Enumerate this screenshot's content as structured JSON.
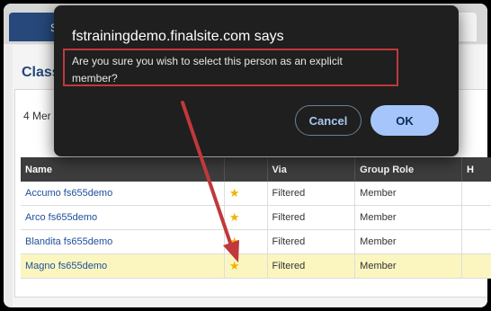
{
  "background": {
    "tab_label": "S",
    "page_heading": "Class",
    "member_count": "4 Mer"
  },
  "table": {
    "headers": [
      "Name",
      "",
      "Via",
      "Group Role",
      "H"
    ],
    "rows": [
      {
        "name": "Accumo fs655demo",
        "via": "Filtered",
        "role": "Member"
      },
      {
        "name": "Arco fs655demo",
        "via": "Filtered",
        "role": "Member"
      },
      {
        "name": "Blandita fs655demo",
        "via": "Filtered",
        "role": "Member"
      },
      {
        "name": "Magno fs655demo",
        "via": "Filtered",
        "role": "Member"
      }
    ]
  },
  "dialog": {
    "title": "fstrainingdemo.finalsite.com says",
    "message": "Are you sure you wish to select this person as an explicit member?",
    "cancel_label": "Cancel",
    "ok_label": "OK"
  },
  "colors": {
    "annotation": "#c0393b",
    "highlight_row": "#fbf6c0",
    "link": "#1f4e9a"
  },
  "icons": {
    "star": "star-icon"
  }
}
